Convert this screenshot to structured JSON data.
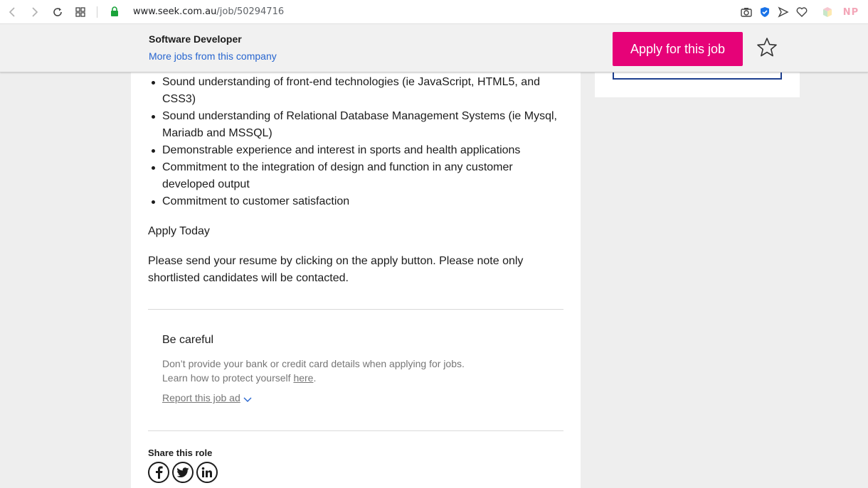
{
  "browser": {
    "url_host": "www.seek.com.au",
    "url_path": "/job/50294716",
    "ext_label": "NP"
  },
  "header": {
    "job_title": "Software Developer",
    "more_jobs": "More jobs from this company",
    "apply_label": "Apply for this job",
    "colors": {
      "apply": "#e60278",
      "link": "#2765cf"
    }
  },
  "content": {
    "bullets": [
      "Sound understanding of front-end technologies (ie JavaScript, HTML5, and CSS3)",
      "Sound understanding of Relational Database Management Systems (ie Mysql, Mariadb and MSSQL)",
      "Demonstrable experience and interest in sports and health applications",
      "Commitment to the integration of design and function in any customer developed output",
      "Commitment to customer satisfaction"
    ],
    "apply_today": "Apply Today",
    "send_resume": "Please send your resume by clicking on the apply button. Please note only shortlisted candidates will be contacted."
  },
  "careful": {
    "title": "Be careful",
    "line1": "Don’t provide your bank or credit card details when applying for jobs.",
    "line2_prefix": "Learn how to protect yourself ",
    "line2_link": "here",
    "line2_suffix": ".",
    "report": "Report this job ad"
  },
  "share": {
    "title": "Share this role",
    "icons": [
      "facebook-icon",
      "twitter-icon",
      "linkedin-icon"
    ]
  }
}
